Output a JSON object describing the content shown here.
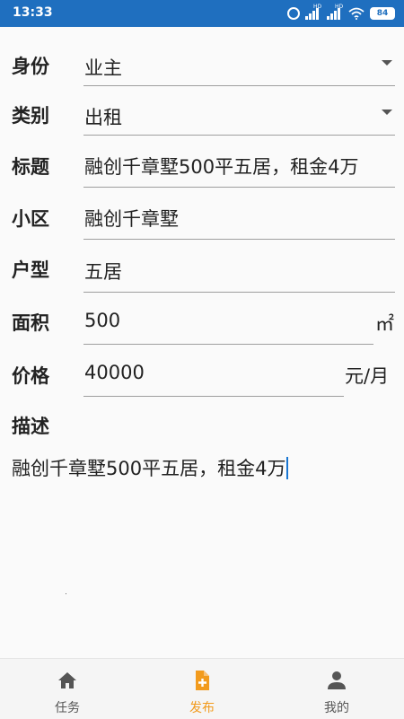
{
  "status_bar": {
    "time": "13:33",
    "battery": "84",
    "network_labels": [
      "HD",
      "HD"
    ]
  },
  "form": {
    "identity": {
      "label": "身份",
      "value": "业主"
    },
    "category": {
      "label": "类别",
      "value": "出租"
    },
    "title": {
      "label": "标题",
      "value": "融创千章墅500平五居，租金4万"
    },
    "community": {
      "label": "小区",
      "value": "融创千章墅"
    },
    "layout": {
      "label": "户型",
      "value": "五居"
    },
    "area": {
      "label": "面积",
      "value": "500",
      "unit": "㎡"
    },
    "price": {
      "label": "价格",
      "value": "40000",
      "unit": "元/月"
    },
    "description": {
      "label": "描述",
      "value": "融创千章墅500平五居，租金4万"
    }
  },
  "bottom_nav": {
    "items": [
      {
        "label": "任务",
        "icon": "home-icon",
        "active": false
      },
      {
        "label": "发布",
        "icon": "add-document-icon",
        "active": true
      },
      {
        "label": "我的",
        "icon": "person-icon",
        "active": false
      }
    ]
  },
  "colors": {
    "status_bar": "#1f6fbf",
    "accent_active": "#f29b1d",
    "cursor": "#1976d2"
  }
}
